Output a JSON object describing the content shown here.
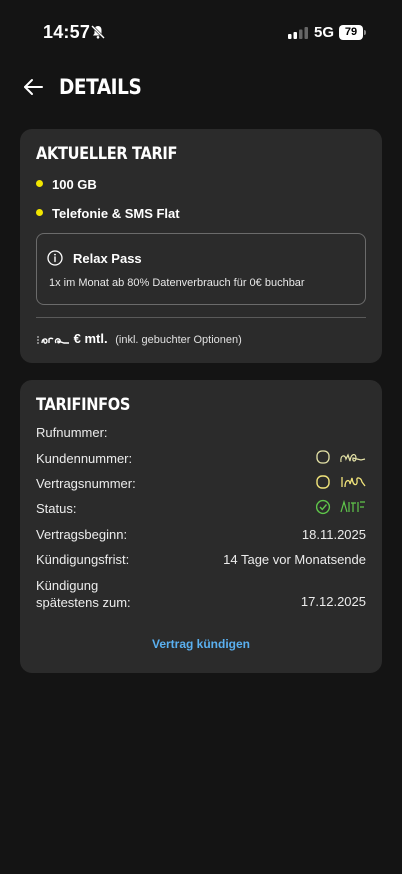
{
  "status_bar": {
    "time": "14:57",
    "network": "5G",
    "battery": "79"
  },
  "header": {
    "title": "DETAILS"
  },
  "current_tariff": {
    "heading": "AKTUELLER TARIF",
    "features": [
      "100 GB",
      "Telefonie & SMS Flat"
    ],
    "pass": {
      "title": "Relax Pass",
      "description": "1x im Monat ab 80% Datenverbrauch für 0€ buchbar"
    },
    "price_suffix": "€ mtl.",
    "price_note": "(inkl. gebuchter Optionen)"
  },
  "tariff_info": {
    "heading": "TARIFINFOS",
    "rows": [
      {
        "label": "Rufnummer:",
        "value": ""
      },
      {
        "label": "Kundennummer:",
        "value": ""
      },
      {
        "label": "Vertragsnummer:",
        "value": ""
      },
      {
        "label": "Status:",
        "value": ""
      },
      {
        "label": "Vertragsbeginn:",
        "value": "18.11.2025"
      },
      {
        "label": "Kündigungsfrist:",
        "value": "14 Tage vor Monatsende"
      },
      {
        "label_line1": "Kündigung",
        "label_line2": "spätestens zum:",
        "value": "17.12.2025"
      }
    ],
    "cancel_link": "Vertrag kündigen"
  },
  "colors": {
    "background": "#141414",
    "card": "#2b2b2b",
    "bullet": "#f2e600",
    "link": "#5ab0f0"
  }
}
